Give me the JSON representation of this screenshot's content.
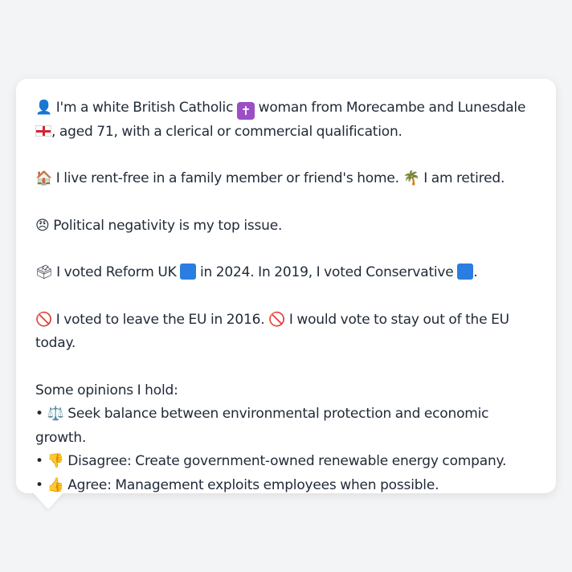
{
  "persona": {
    "intro": {
      "icon": "person-silhouette-icon",
      "text_a": "I'm a white British Catholic",
      "religion_icon": "latin-cross-icon",
      "text_b": "woman from Morecambe and Lunesdale",
      "flag_icon": "england-flag-icon",
      "text_c": ", aged 71, with a clerical or commercial qualification."
    },
    "housing": {
      "icon": "house-icon",
      "text_a": "I live rent-free in a family member or friend's home.",
      "work_icon": "palm-tree-icon",
      "text_b": "I am retired."
    },
    "issue": {
      "icon": "angry-face-icon",
      "text": "Political negativity is my top issue."
    },
    "votes": {
      "icon": "ballot-box-icon",
      "text_a": "I voted Reform UK",
      "party_icon_1": "blue-square-icon",
      "text_b": "in 2024. In 2019, I voted Conservative",
      "party_icon_2": "blue-square-icon",
      "text_c": "."
    },
    "eu": {
      "icon_1": "prohibited-icon",
      "text_a": "I voted to leave the EU in 2016.",
      "icon_2": "prohibited-icon",
      "text_b": "I would vote to stay out of the EU today."
    },
    "opinions": {
      "heading": "Some opinions I hold:",
      "items": [
        {
          "bullet": "•",
          "icon": "balance-scale-icon",
          "text": "Seek balance between environmental protection and economic growth."
        },
        {
          "bullet": "•",
          "icon": "thumbs-down-icon",
          "text": "Disagree: Create government-owned renewable energy company."
        },
        {
          "bullet": "•",
          "icon": "thumbs-up-icon",
          "text": "Agree: Management exploits employees when possible."
        }
      ]
    }
  },
  "colors": {
    "background": "#f3f4f6",
    "card": "#ffffff",
    "text": "#1f2937",
    "party_blue": "#2a7de1",
    "cross_purple": "#9b4fc6",
    "flag_red": "#d22630"
  }
}
